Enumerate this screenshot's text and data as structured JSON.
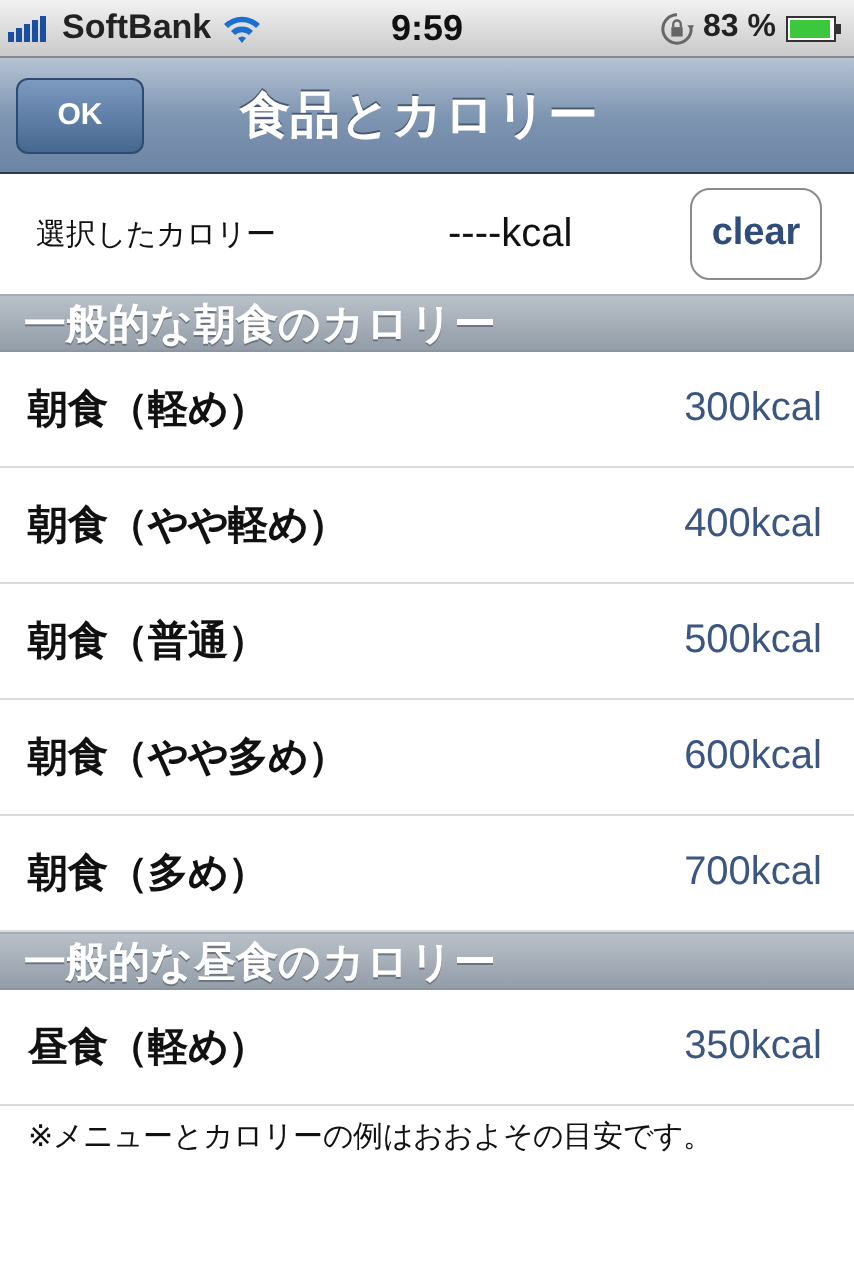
{
  "status_bar": {
    "carrier": "SoftBank",
    "time": "9:59",
    "battery": "83 %"
  },
  "nav_bar": {
    "title": "食品とカロリー",
    "ok_button": "OK"
  },
  "selection": {
    "label": "選択したカロリー",
    "value": "----kcal",
    "clear_button": "clear"
  },
  "sections": [
    {
      "header": "一般的な朝食のカロリー",
      "rows": [
        {
          "name": "朝食（軽め）",
          "calories": "300kcal"
        },
        {
          "name": "朝食（やや軽め）",
          "calories": "400kcal"
        },
        {
          "name": "朝食（普通）",
          "calories": "500kcal"
        },
        {
          "name": "朝食（やや多め）",
          "calories": "600kcal"
        },
        {
          "name": "朝食（多め）",
          "calories": "700kcal"
        }
      ]
    },
    {
      "header": "一般的な昼食のカロリー",
      "rows": [
        {
          "name": "昼食（軽め）",
          "calories": "350kcal"
        }
      ]
    }
  ],
  "note": "※メニューとカロリーの例はおおよその目安です。"
}
